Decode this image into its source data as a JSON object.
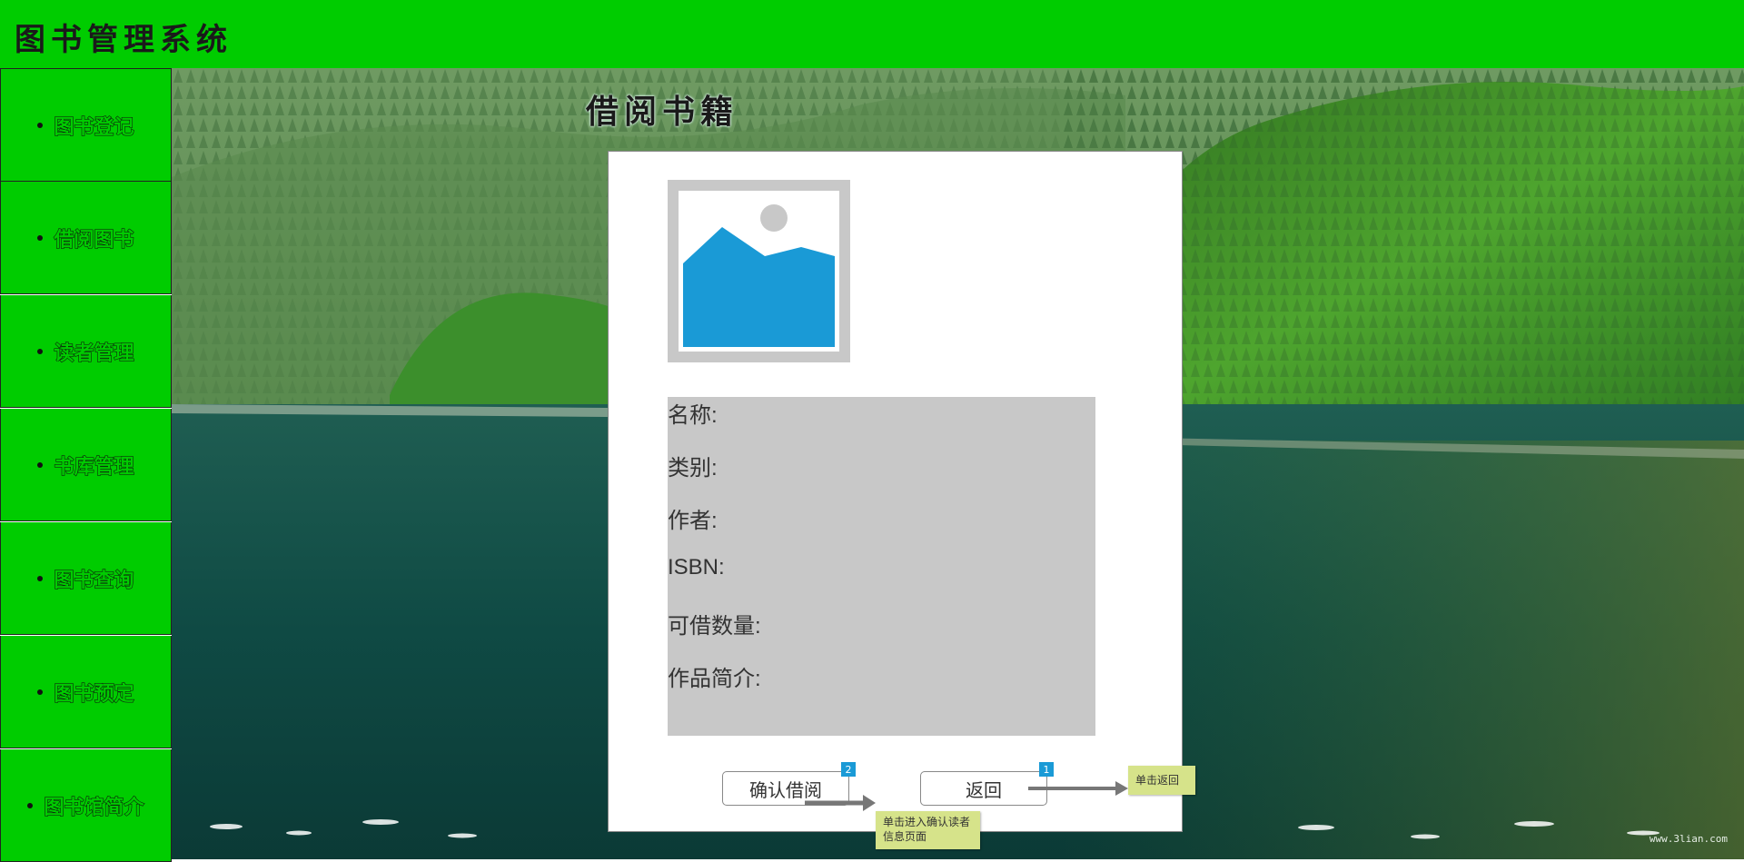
{
  "header": {
    "title": "图书管理系统",
    "background_color": "#00cc00"
  },
  "sidebar": {
    "items": [
      {
        "label": "图书登记"
      },
      {
        "label": "借阅图书"
      },
      {
        "label": "读者管理"
      },
      {
        "label": "书库管理"
      },
      {
        "label": "图书查询"
      },
      {
        "label": "图书预定"
      },
      {
        "label": "图书馆简介"
      }
    ]
  },
  "main": {
    "page_title": "借阅书籍",
    "book_image_icon": "image-placeholder-icon",
    "fields": [
      {
        "label": "名称:"
      },
      {
        "label": "类别:"
      },
      {
        "label": "作者:"
      },
      {
        "label": "ISBN:"
      },
      {
        "label": "可借数量:"
      },
      {
        "label": "作品简介:"
      }
    ],
    "buttons": {
      "confirm_label": "确认借阅",
      "confirm_badge": "2",
      "back_label": "返回",
      "back_badge": "1"
    },
    "notes": {
      "confirm_note": "单击进入确认读者信息页面",
      "back_note": "单击返回"
    }
  },
  "background": {
    "watermark": "www.3lian.com"
  },
  "colors": {
    "accent_green": "#00cc00",
    "image_blue": "#1a9ad6",
    "note_yellow": "#d6e38a",
    "panel_gray": "#c8c8c8"
  }
}
